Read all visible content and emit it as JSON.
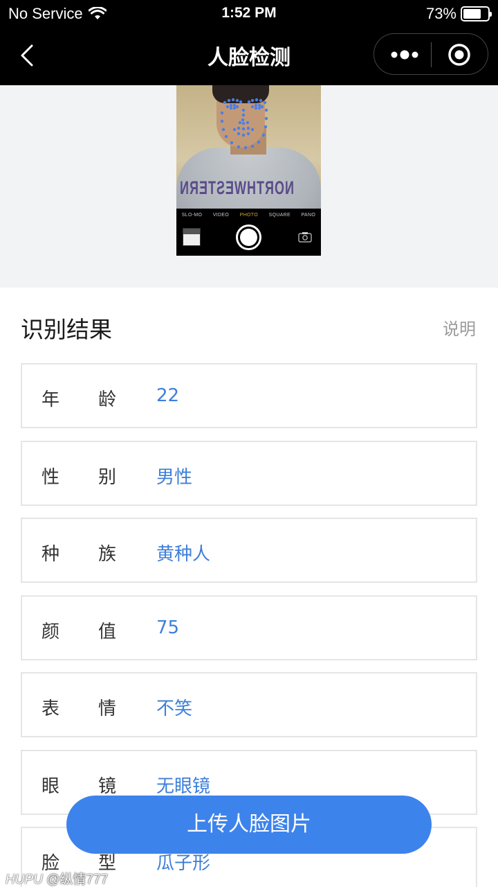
{
  "status_bar": {
    "carrier": "No Service",
    "time": "1:52 PM",
    "battery_percent": "73%",
    "battery_level": 0.73
  },
  "nav_bar": {
    "title": "人脸检测",
    "back_icon": "chevron-left-icon",
    "more_icon": "more-dots-icon",
    "close_icon": "target-circle-icon"
  },
  "photo": {
    "camera_modes": [
      "SLO-MO",
      "VIDEO",
      "PHOTO",
      "SQUARE",
      "PANO"
    ],
    "active_mode": "PHOTO",
    "shirt_text": "NORTHWESTERN"
  },
  "result": {
    "title": "识别结果",
    "help_label": "说明",
    "rows": [
      {
        "label1": "年",
        "label2": "龄",
        "value": "22"
      },
      {
        "label1": "性",
        "label2": "别",
        "value": "男性"
      },
      {
        "label1": "种",
        "label2": "族",
        "value": "黄种人"
      },
      {
        "label1": "颜",
        "label2": "值",
        "value": "75"
      },
      {
        "label1": "表",
        "label2": "情",
        "value": "不笑"
      },
      {
        "label1": "眼",
        "label2": "镜",
        "value": "无眼镜"
      },
      {
        "label1": "脸",
        "label2": "型",
        "value": "瓜子形"
      }
    ]
  },
  "upload_button": {
    "label": "上传人脸图片"
  },
  "watermark": {
    "brand": "HUPU",
    "user": "@纵情777"
  },
  "colors": {
    "accent": "#3d83ec",
    "value_text": "#3d7fd9",
    "landmark": "#4a7ee8"
  }
}
